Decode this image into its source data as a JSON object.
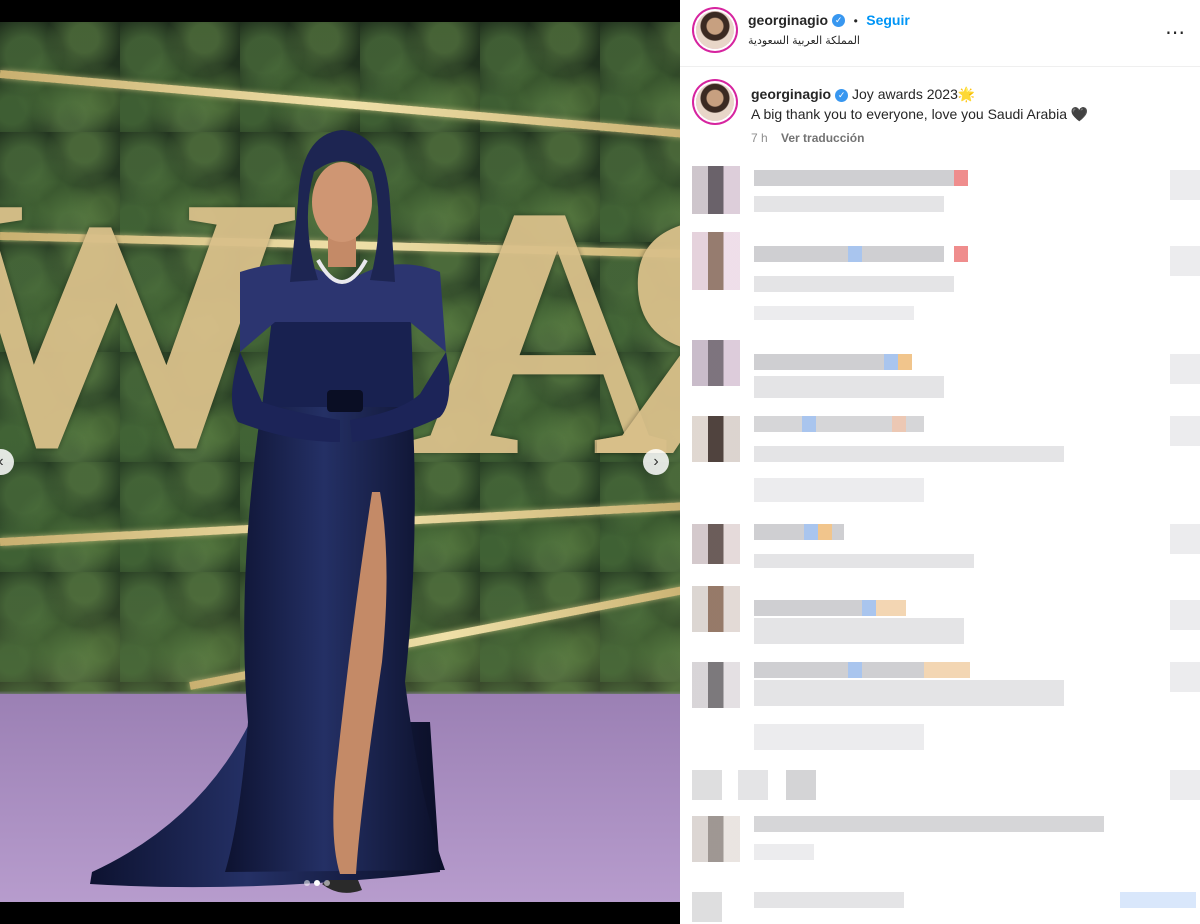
{
  "post": {
    "username": "georginagio",
    "follow_label": "Seguir",
    "separator": "•",
    "location": "المملكة العربية السعودية",
    "more_icon": "⋯",
    "caption_title": "Joy awards 2023",
    "caption_emoji": "🌟",
    "caption_line2": "A big thank you to everyone, love you Saudi Arabia",
    "caption_heart": "🖤",
    "time_ago": "7 h",
    "translate_label": "Ver traducción"
  },
  "carousel": {
    "slides_total": 3,
    "active_slide": 2,
    "prev_icon": "chevron-left-icon",
    "next_icon": "chevron-right-icon"
  },
  "colors": {
    "accent": "#0095f6",
    "verified": "#3897f0",
    "text": "#262626",
    "muted": "#8e8e8e"
  }
}
